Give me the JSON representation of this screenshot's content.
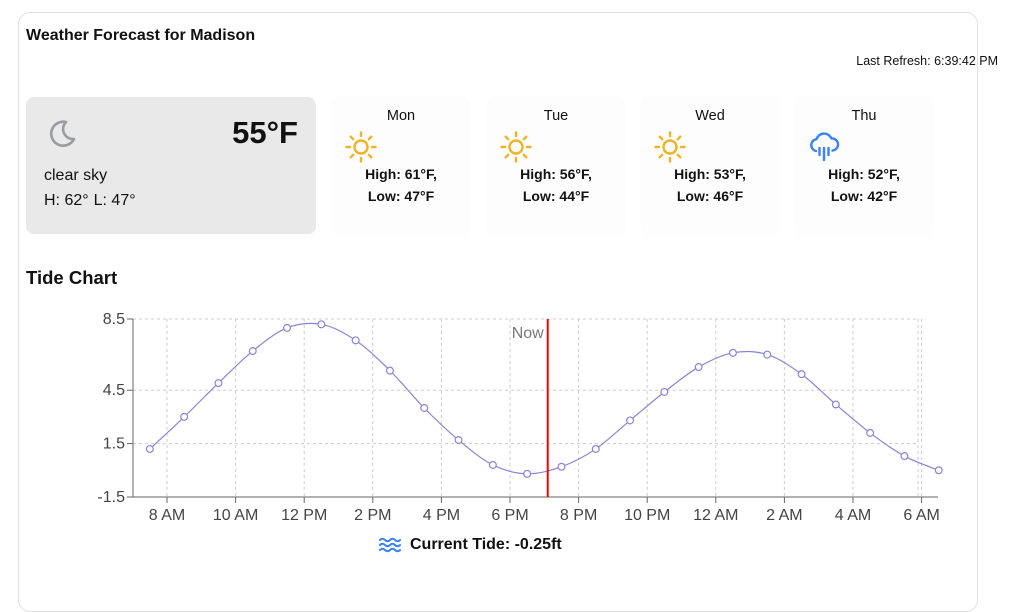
{
  "app": {
    "title": "Weather Forecast for Madison",
    "last_refresh": "Last Refresh: 6:39:42 PM"
  },
  "current": {
    "temperature": "55°F",
    "description": "clear sky",
    "high": "H: 62°",
    "low": "L: 47°",
    "icon": "moon-icon"
  },
  "forecast": [
    {
      "day": "Mon",
      "high": "High: 61°F,",
      "low": "Low: 47°F",
      "icon": "sun-icon"
    },
    {
      "day": "Tue",
      "high": "High: 56°F,",
      "low": "Low: 44°F",
      "icon": "sun-icon"
    },
    {
      "day": "Wed",
      "high": "High: 53°F,",
      "low": "Low: 46°F",
      "icon": "sun-icon"
    },
    {
      "day": "Thu",
      "high": "High: 52°F,",
      "low": "Low: 42°F",
      "icon": "cloud-rain-icon"
    }
  ],
  "colors": {
    "sun": "#f0b323",
    "rain": "#3b82f6",
    "moon": "#9a9ca3",
    "tide_line": "#8884d8",
    "now_line": "#ff0000",
    "grid": "#cccccc"
  },
  "tide": {
    "title": "Tide Chart",
    "current_label": "Current Tide: -0.25ft"
  },
  "chart_data": {
    "type": "line",
    "title": "Tide Chart",
    "xlabel": "",
    "ylabel": "",
    "x_tick_labels": [
      "8 AM",
      "10 AM",
      "12 PM",
      "2 PM",
      "4 PM",
      "6 PM",
      "8 PM",
      "10 PM",
      "12 AM",
      "2 AM",
      "4 AM",
      "6 AM"
    ],
    "y_ticks": [
      8.5,
      4.5,
      1.5,
      -1.5
    ],
    "ylim": [
      -1.5,
      8.5
    ],
    "x_hours": [
      7.5,
      8.5,
      9.5,
      10.5,
      11.5,
      12.5,
      13.5,
      14.5,
      15.5,
      16.5,
      17.5,
      18.5,
      19.5,
      20.5,
      21.5,
      22.5,
      23.5,
      24.5,
      25.5,
      26.5,
      27.5,
      28.5,
      29.5,
      30.5
    ],
    "values": [
      1.2,
      3.0,
      4.9,
      6.7,
      8.0,
      8.2,
      7.3,
      5.6,
      3.5,
      1.7,
      0.3,
      -0.2,
      0.2,
      1.2,
      2.8,
      4.4,
      5.8,
      6.6,
      6.5,
      5.4,
      3.7,
      2.1,
      0.8,
      0.0
    ],
    "now_hour": 19.1,
    "now_label": "Now",
    "grid": true,
    "legend": "none"
  }
}
